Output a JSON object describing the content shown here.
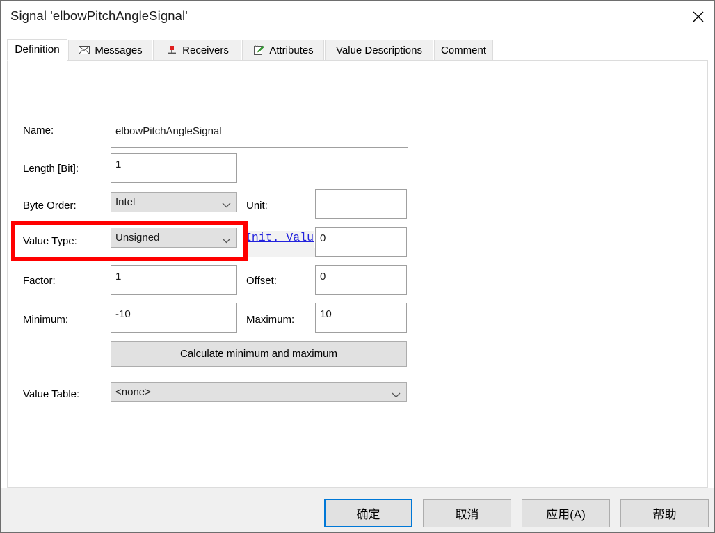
{
  "window": {
    "title": "Signal 'elbowPitchAngleSignal'",
    "close_icon": "close-icon"
  },
  "tabs": [
    {
      "label": "Definition",
      "icon": "",
      "selected": true
    },
    {
      "label": "Messages",
      "icon": "envelope-icon",
      "selected": false
    },
    {
      "label": "Receivers",
      "icon": "red-pin-icon",
      "selected": false
    },
    {
      "label": "Attributes",
      "icon": "notepad-pencil-icon",
      "selected": false
    },
    {
      "label": "Value Descriptions",
      "icon": "",
      "selected": false
    },
    {
      "label": "Comment",
      "icon": "",
      "selected": false
    }
  ],
  "form": {
    "name": {
      "label": "Name:",
      "value": "elbowPitchAngleSignal"
    },
    "length": {
      "label": "Length [Bit]:",
      "value": "1"
    },
    "byte_order": {
      "label": "Byte Order:",
      "value": "Intel"
    },
    "unit": {
      "label": "Unit:",
      "value": ""
    },
    "value_type": {
      "label": "Value Type:",
      "value": "Unsigned"
    },
    "init_value": {
      "label": "Init. Value",
      "value": "0"
    },
    "factor": {
      "label": "Factor:",
      "value": "1"
    },
    "offset": {
      "label": "Offset:",
      "value": "0"
    },
    "minimum": {
      "label": "Minimum:",
      "value": "-10"
    },
    "maximum": {
      "label": "Maximum:",
      "value": "10"
    },
    "calc_button": {
      "label": "Calculate minimum and maximum"
    },
    "value_table": {
      "label": "Value Table:",
      "value": "<none>"
    }
  },
  "footer": {
    "ok": "确定",
    "cancel": "取消",
    "apply": "应用(A)",
    "help": "帮助"
  },
  "colors": {
    "highlight_box": "#ff0000",
    "link": "#2222dd",
    "default_button_border": "#0078d7"
  }
}
